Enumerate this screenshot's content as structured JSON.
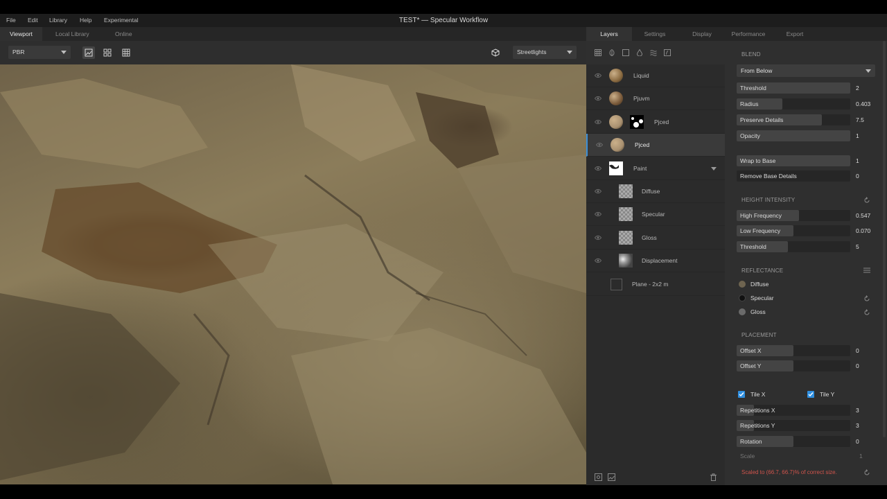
{
  "menu": [
    "File",
    "Edit",
    "Library",
    "Help",
    "Experimental"
  ],
  "window_title": "TEST* — Specular Workflow",
  "left_tabs": [
    "Viewport",
    "Local Library",
    "Online"
  ],
  "viewport": {
    "render_mode": "PBR",
    "environment": "Streetlights"
  },
  "right_tabs": [
    "Layers",
    "Settings",
    "Display",
    "Performance",
    "Export"
  ],
  "layer_tool_icons": [
    "grid-icon",
    "leaf-icon",
    "square-icon",
    "drop-icon",
    "waves-icon",
    "function-icon"
  ],
  "layers": [
    {
      "name": "Liquid",
      "thumb": "ball",
      "color": "#8a6a40"
    },
    {
      "name": "Pjuvm",
      "thumb": "ball",
      "color": "#7a5a3a"
    },
    {
      "name": "Pjced",
      "thumb": "ball",
      "color": "#a89070",
      "mask": true
    },
    {
      "name": "Pjced",
      "thumb": "ball",
      "color": "#a89070",
      "selected": true
    },
    {
      "name": "Paint",
      "thumb": "paint",
      "expandable": true
    },
    {
      "name": "Diffuse",
      "thumb": "checker"
    },
    {
      "name": "Specular",
      "thumb": "checker"
    },
    {
      "name": "Gloss",
      "thumb": "checker"
    },
    {
      "name": "Displacement",
      "thumb": "noise"
    },
    {
      "name": "Plane - 2x2 m",
      "thumb": "plane"
    }
  ],
  "blend": {
    "heading": "BLEND",
    "mode": "From Below",
    "threshold": {
      "label": "Threshold",
      "value": "2",
      "fraction": 1.0
    },
    "radius": {
      "label": "Radius",
      "value": "0.403",
      "fraction": 0.4
    },
    "preserve_details": {
      "label": "Preserve Details",
      "value": "7.5",
      "fraction": 0.75
    },
    "opacity": {
      "label": "Opacity",
      "value": "1",
      "fraction": 1.0
    },
    "wrap_to_base": {
      "label": "Wrap to Base",
      "value": "1",
      "fraction": 1.0
    },
    "remove_base_details": {
      "label": "Remove Base Details",
      "value": "0",
      "fraction": 0.0
    }
  },
  "height_intensity": {
    "heading": "HEIGHT INTENSITY",
    "high_frequency": {
      "label": "High Frequency",
      "value": "0.547",
      "fraction": 0.55
    },
    "low_frequency": {
      "label": "Low Frequency",
      "value": "0.070",
      "fraction": 0.5
    },
    "threshold": {
      "label": "Threshold",
      "value": "5",
      "fraction": 0.45
    }
  },
  "reflectance": {
    "heading": "REFLECTANCE",
    "diffuse": {
      "label": "Diffuse",
      "color": "#6e6450"
    },
    "specular": {
      "label": "Specular",
      "color": "#111111"
    },
    "gloss": {
      "label": "Gloss",
      "color": "#6a6a6a"
    }
  },
  "placement": {
    "heading": "PLACEMENT",
    "offset_x": {
      "label": "Offset X",
      "value": "0",
      "fraction": 0.5
    },
    "offset_y": {
      "label": "Offset Y",
      "value": "0",
      "fraction": 0.5
    },
    "tile_x": {
      "label": "Tile X",
      "checked": true
    },
    "tile_y": {
      "label": "Tile Y",
      "checked": true
    },
    "repetitions_x": {
      "label": "Repetitions X",
      "value": "3",
      "fraction": 0.15
    },
    "repetitions_y": {
      "label": "Repetitions Y",
      "value": "3",
      "fraction": 0.15
    },
    "rotation": {
      "label": "Rotation",
      "value": "0",
      "fraction": 0.5
    },
    "scale": {
      "label": "Scale",
      "value": "1"
    }
  },
  "warning": "Scaled to (66.7, 66.7)% of correct size.",
  "colors": {
    "accent": "#3b8fd8",
    "warning": "#d0544c"
  }
}
